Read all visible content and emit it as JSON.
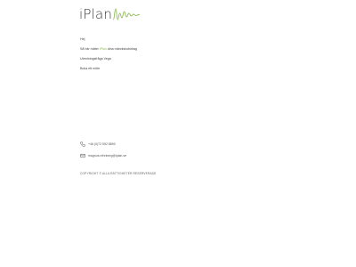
{
  "header": {
    "logo_text": "iPlan",
    "accent_color": "#8fbc57"
  },
  "menu": {
    "items": [
      {
        "label": "Hej"
      },
      {
        "label_before": "Så här mäter ",
        "label_accent": "iPlan",
        "label_after": " dina människobidrag"
      },
      {
        "label": "Utredningsfråga Vega"
      },
      {
        "label": "Boka ett möte"
      }
    ]
  },
  "contact": {
    "phone": "+46 (0)72 552 8890",
    "email": "magnus.rehnberg@iplan.se",
    "phone_icon": "phone-icon",
    "email_icon": "mail-icon"
  },
  "footer": {
    "copyright": "COPYRIGHT © ALLA RÄTTIGHETER RESERVERADE"
  }
}
